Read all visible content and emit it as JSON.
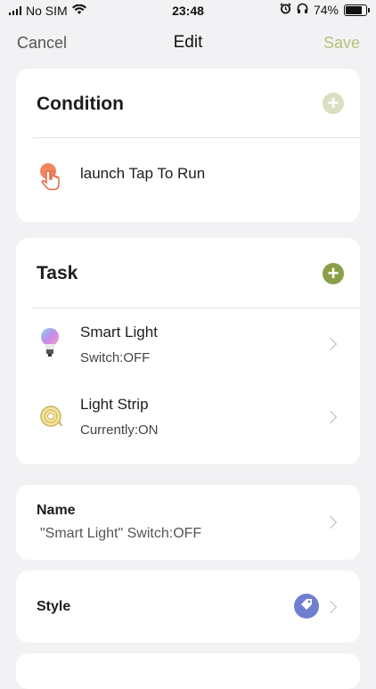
{
  "status_bar": {
    "carrier": "No SIM",
    "time": "23:48",
    "battery": "74%",
    "icons": [
      "wifi-icon",
      "alarm-icon",
      "headphones-icon",
      "battery-icon"
    ]
  },
  "nav": {
    "cancel": "Cancel",
    "title": "Edit",
    "save": "Save"
  },
  "condition": {
    "title": "Condition",
    "add_icon": "plus-circle-icon",
    "item": {
      "label": "launch Tap To Run",
      "icon": "tap-hand-icon"
    }
  },
  "task": {
    "title": "Task",
    "add_icon": "plus-circle-icon",
    "items": [
      {
        "title": "Smart Light",
        "subtitle": "Switch:OFF",
        "icon": "bulb-icon"
      },
      {
        "title": "Light Strip",
        "subtitle": "Currently:ON",
        "icon": "light-strip-icon"
      }
    ]
  },
  "name": {
    "label": "Name",
    "value": "\"Smart Light\" Switch:OFF"
  },
  "style": {
    "label": "Style",
    "icon": "tag-icon"
  },
  "colors": {
    "accent_green": "#8aa048",
    "accent_green_light": "#d9dfc0",
    "save_text": "#b7c07a",
    "style_badge": "#6f7fd0",
    "tap_icon": "#f07a4f"
  }
}
